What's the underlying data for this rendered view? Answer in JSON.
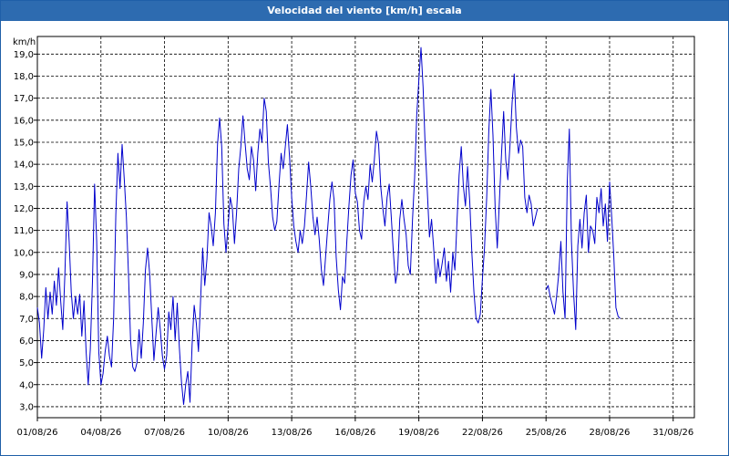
{
  "window": {
    "title": "Velocidad del viento [km/h] escala"
  },
  "chart_data": {
    "type": "line",
    "title": "Velocidad del viento [km/h] escala",
    "ylabel": "km/h",
    "xlabel": "",
    "ylim": [
      2.5,
      19.8
    ],
    "xlim": [
      "01/08/26",
      "01/09/26"
    ],
    "grid": true,
    "line_color": "#0000cc",
    "yticks": [
      "3,0",
      "4,0",
      "5,0",
      "6,0",
      "7,0",
      "8,0",
      "9,0",
      "10,0",
      "11,0",
      "12,0",
      "13,0",
      "14,0",
      "15,0",
      "16,0",
      "17,0",
      "18,0",
      "19,0"
    ],
    "xticks": [
      "01/08/26",
      "04/08/26",
      "07/08/26",
      "10/08/26",
      "13/08/26",
      "16/08/26",
      "19/08/26",
      "22/08/26",
      "25/08/26",
      "28/08/26",
      "31/08/26"
    ],
    "series": [
      {
        "segments": [
          [
            [
              0.0,
              7.5
            ],
            [
              0.1,
              6.8
            ],
            [
              0.2,
              5.2
            ],
            [
              0.3,
              6.5
            ],
            [
              0.4,
              8.4
            ],
            [
              0.5,
              7.0
            ],
            [
              0.6,
              8.2
            ],
            [
              0.7,
              7.2
            ],
            [
              0.8,
              8.7
            ],
            [
              0.9,
              7.6
            ],
            [
              1.0,
              9.3
            ],
            [
              1.1,
              7.8
            ],
            [
              1.2,
              6.5
            ],
            [
              1.3,
              9.0
            ],
            [
              1.4,
              12.3
            ],
            [
              1.5,
              10.5
            ],
            [
              1.6,
              8.2
            ],
            [
              1.7,
              7.0
            ],
            [
              1.8,
              8.0
            ],
            [
              1.9,
              7.2
            ],
            [
              2.0,
              8.1
            ],
            [
              2.1,
              6.2
            ],
            [
              2.2,
              7.8
            ],
            [
              2.3,
              5.5
            ],
            [
              2.4,
              4.0
            ],
            [
              2.5,
              5.6
            ],
            [
              2.6,
              8.7
            ],
            [
              2.7,
              13.1
            ],
            [
              2.8,
              10.5
            ],
            [
              2.9,
              5.5
            ],
            [
              3.0,
              4.0
            ],
            [
              3.1,
              4.5
            ],
            [
              3.2,
              5.5
            ],
            [
              3.3,
              6.2
            ],
            [
              3.4,
              5.3
            ],
            [
              3.5,
              4.8
            ],
            [
              3.6,
              7.0
            ],
            [
              3.7,
              11.7
            ],
            [
              3.8,
              14.5
            ],
            [
              3.9,
              12.9
            ],
            [
              4.0,
              14.9
            ],
            [
              4.1,
              13.3
            ],
            [
              4.2,
              11.6
            ],
            [
              4.3,
              9.0
            ],
            [
              4.4,
              6.0
            ],
            [
              4.5,
              4.8
            ],
            [
              4.6,
              4.6
            ],
            [
              4.7,
              5.0
            ],
            [
              4.8,
              6.5
            ],
            [
              4.9,
              5.2
            ],
            [
              5.0,
              6.8
            ],
            [
              5.1,
              9.2
            ],
            [
              5.2,
              10.2
            ],
            [
              5.3,
              9.0
            ],
            [
              5.4,
              7.0
            ],
            [
              5.5,
              5.1
            ],
            [
              5.6,
              6.3
            ],
            [
              5.7,
              7.5
            ],
            [
              5.8,
              6.5
            ],
            [
              5.9,
              5.3
            ],
            [
              6.0,
              4.7
            ],
            [
              6.1,
              5.3
            ],
            [
              6.2,
              7.3
            ],
            [
              6.3,
              6.5
            ],
            [
              6.4,
              8.0
            ],
            [
              6.5,
              6.0
            ],
            [
              6.6,
              7.7
            ],
            [
              6.7,
              5.7
            ],
            [
              6.8,
              4.1
            ],
            [
              6.9,
              3.1
            ],
            [
              7.0,
              4.0
            ],
            [
              7.1,
              4.6
            ],
            [
              7.2,
              3.2
            ],
            [
              7.3,
              5.8
            ],
            [
              7.4,
              7.6
            ],
            [
              7.5,
              6.8
            ],
            [
              7.6,
              5.5
            ],
            [
              7.7,
              7.8
            ],
            [
              7.8,
              10.2
            ],
            [
              7.9,
              8.5
            ],
            [
              8.0,
              9.7
            ],
            [
              8.1,
              11.8
            ],
            [
              8.2,
              11.2
            ],
            [
              8.3,
              10.3
            ],
            [
              8.4,
              11.8
            ],
            [
              8.5,
              14.9
            ],
            [
              8.6,
              16.1
            ],
            [
              8.7,
              14.8
            ],
            [
              8.8,
              11.3
            ],
            [
              8.9,
              10.0
            ],
            [
              9.0,
              11.2
            ],
            [
              9.1,
              12.5
            ],
            [
              9.2,
              12.0
            ],
            [
              9.3,
              10.4
            ],
            [
              9.4,
              11.8
            ],
            [
              9.5,
              13.8
            ],
            [
              9.6,
              14.8
            ],
            [
              9.7,
              16.2
            ],
            [
              9.8,
              15.0
            ],
            [
              9.9,
              13.8
            ],
            [
              10.0,
              13.3
            ],
            [
              10.1,
              14.8
            ],
            [
              10.2,
              14.2
            ],
            [
              10.3,
              12.8
            ],
            [
              10.4,
              14.5
            ],
            [
              10.5,
              15.6
            ],
            [
              10.6,
              15.0
            ],
            [
              10.7,
              17.0
            ],
            [
              10.8,
              16.4
            ],
            [
              10.9,
              14.1
            ],
            [
              11.0,
              13.0
            ],
            [
              11.1,
              11.6
            ],
            [
              11.2,
              11.0
            ],
            [
              11.3,
              11.4
            ],
            [
              11.4,
              13.0
            ],
            [
              11.5,
              14.5
            ],
            [
              11.6,
              13.8
            ],
            [
              11.7,
              14.8
            ],
            [
              11.8,
              15.8
            ],
            [
              11.9,
              14.3
            ],
            [
              12.0,
              12.5
            ],
            [
              12.1,
              11.2
            ],
            [
              12.2,
              10.5
            ],
            [
              12.3,
              10.0
            ],
            [
              12.4,
              11.0
            ],
            [
              12.5,
              10.4
            ],
            [
              12.6,
              11.2
            ],
            [
              12.7,
              12.6
            ],
            [
              12.8,
              14.1
            ],
            [
              12.9,
              13.0
            ],
            [
              13.0,
              11.6
            ],
            [
              13.1,
              10.8
            ],
            [
              13.2,
              11.6
            ],
            [
              13.3,
              10.6
            ],
            [
              13.4,
              9.2
            ],
            [
              13.5,
              8.5
            ],
            [
              13.6,
              9.8
            ],
            [
              13.7,
              11.1
            ],
            [
              13.8,
              12.4
            ],
            [
              13.9,
              13.2
            ],
            [
              14.0,
              12.4
            ],
            [
              14.1,
              9.8
            ],
            [
              14.2,
              8.3
            ],
            [
              14.3,
              7.4
            ],
            [
              14.4,
              8.9
            ],
            [
              14.5,
              8.6
            ],
            [
              14.6,
              10.5
            ],
            [
              14.7,
              12.1
            ],
            [
              14.8,
              13.5
            ],
            [
              14.9,
              14.2
            ],
            [
              15.0,
              12.7
            ],
            [
              15.1,
              12.3
            ],
            [
              15.2,
              11.0
            ],
            [
              15.3,
              10.6
            ],
            [
              15.4,
              12.3
            ],
            [
              15.5,
              13.0
            ],
            [
              15.6,
              12.4
            ],
            [
              15.7,
              14.0
            ],
            [
              15.8,
              13.2
            ],
            [
              15.9,
              14.2
            ],
            [
              16.0,
              15.5
            ],
            [
              16.1,
              14.9
            ],
            [
              16.2,
              13.0
            ],
            [
              16.3,
              12.0
            ],
            [
              16.4,
              11.2
            ],
            [
              16.5,
              12.5
            ],
            [
              16.6,
              13.1
            ],
            [
              16.7,
              11.6
            ],
            [
              16.8,
              10.0
            ],
            [
              16.9,
              8.6
            ],
            [
              17.0,
              9.2
            ],
            [
              17.1,
              11.5
            ],
            [
              17.2,
              12.4
            ],
            [
              17.3,
              11.5
            ],
            [
              17.4,
              10.8
            ],
            [
              17.5,
              9.4
            ],
            [
              17.6,
              9.0
            ],
            [
              17.7,
              11.5
            ],
            [
              17.8,
              13.4
            ],
            [
              17.9,
              16.2
            ],
            [
              18.0,
              17.8
            ],
            [
              18.1,
              19.3
            ],
            [
              18.2,
              17.5
            ],
            [
              18.3,
              14.8
            ],
            [
              18.4,
              12.8
            ],
            [
              18.5,
              10.7
            ],
            [
              18.6,
              11.5
            ],
            [
              18.7,
              10.2
            ],
            [
              18.8,
              8.6
            ],
            [
              18.9,
              9.7
            ],
            [
              19.0,
              8.9
            ],
            [
              19.1,
              9.5
            ],
            [
              19.2,
              10.2
            ],
            [
              19.3,
              8.7
            ],
            [
              19.4,
              9.6
            ],
            [
              19.5,
              8.2
            ],
            [
              19.6,
              10.0
            ],
            [
              19.7,
              9.2
            ],
            [
              19.8,
              11.4
            ],
            [
              19.9,
              13.5
            ],
            [
              20.0,
              14.8
            ],
            [
              20.1,
              13.0
            ],
            [
              20.2,
              12.1
            ],
            [
              20.3,
              13.9
            ],
            [
              20.4,
              12.3
            ],
            [
              20.5,
              10.0
            ],
            [
              20.6,
              8.2
            ],
            [
              20.7,
              7.0
            ],
            [
              20.8,
              6.8
            ],
            [
              20.9,
              7.2
            ],
            [
              21.0,
              8.8
            ],
            [
              21.1,
              10.2
            ],
            [
              21.2,
              12.5
            ],
            [
              21.3,
              15.5
            ],
            [
              21.4,
              17.4
            ],
            [
              21.5,
              15.3
            ],
            [
              21.6,
              12.0
            ],
            [
              21.7,
              10.2
            ],
            [
              21.8,
              12.3
            ],
            [
              21.9,
              14.5
            ],
            [
              22.0,
              16.4
            ],
            [
              22.1,
              14.2
            ],
            [
              22.2,
              13.3
            ],
            [
              22.3,
              14.9
            ],
            [
              22.4,
              16.8
            ],
            [
              22.5,
              18.1
            ],
            [
              22.6,
              15.7
            ],
            [
              22.7,
              14.5
            ],
            [
              22.8,
              15.1
            ],
            [
              22.9,
              14.8
            ],
            [
              23.0,
              12.5
            ],
            [
              23.1,
              11.8
            ],
            [
              23.2,
              12.6
            ],
            [
              23.3,
              12.2
            ],
            [
              23.4,
              11.2
            ],
            [
              23.5,
              11.6
            ],
            [
              23.6,
              12.0
            ]
          ],
          [
            [
              24.0,
              8.3
            ],
            [
              24.1,
              8.5
            ],
            [
              24.2,
              8.0
            ],
            [
              24.3,
              7.6
            ],
            [
              24.4,
              7.2
            ],
            [
              24.5,
              8.0
            ],
            [
              24.6,
              9.0
            ],
            [
              24.7,
              10.5
            ],
            [
              24.8,
              8.2
            ],
            [
              24.9,
              7.0
            ],
            [
              25.0,
              13.2
            ],
            [
              25.1,
              15.6
            ],
            [
              25.2,
              10.5
            ],
            [
              25.3,
              8.2
            ],
            [
              25.4,
              6.5
            ],
            [
              25.5,
              10.3
            ],
            [
              25.6,
              11.5
            ],
            [
              25.7,
              10.2
            ],
            [
              25.8,
              11.8
            ],
            [
              25.9,
              12.6
            ],
            [
              26.0,
              10.0
            ],
            [
              26.1,
              11.2
            ],
            [
              26.2,
              11.0
            ],
            [
              26.3,
              10.4
            ],
            [
              26.4,
              12.5
            ],
            [
              26.5,
              11.8
            ],
            [
              26.6,
              12.9
            ],
            [
              26.7,
              11.2
            ],
            [
              26.8,
              12.2
            ],
            [
              26.9,
              10.5
            ],
            [
              27.0,
              13.2
            ],
            [
              27.1,
              11.6
            ],
            [
              27.2,
              9.8
            ],
            [
              27.3,
              7.5
            ],
            [
              27.4,
              7.1
            ],
            [
              27.5,
              7.0
            ]
          ]
        ]
      }
    ]
  }
}
